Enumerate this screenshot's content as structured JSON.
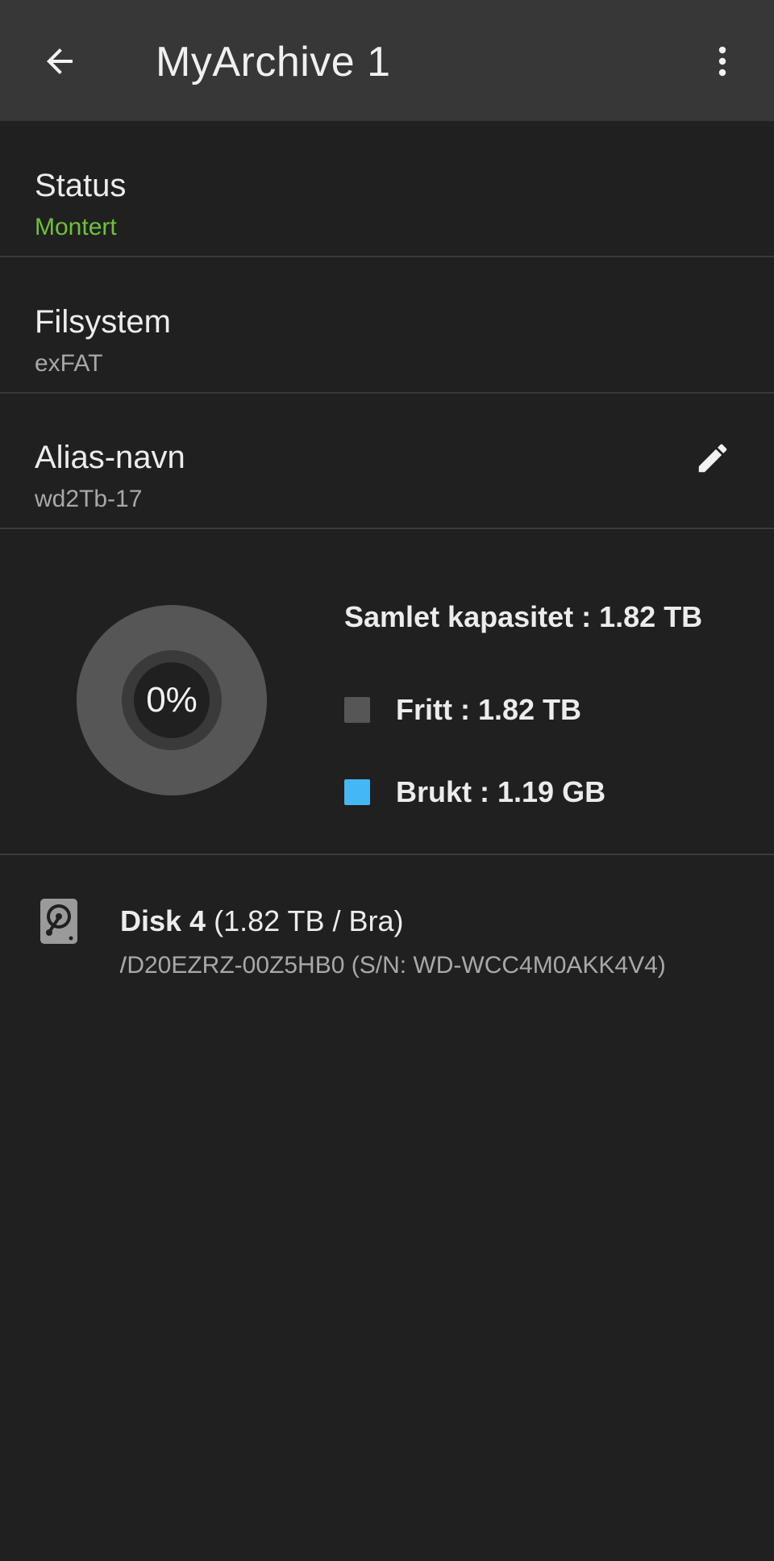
{
  "appbar": {
    "title": "MyArchive 1",
    "back_icon": "arrow-back-icon",
    "menu_icon": "more-vert-icon"
  },
  "status": {
    "label": "Status",
    "value": "Montert",
    "value_color": "#6fc13a"
  },
  "filesystem": {
    "label": "Filsystem",
    "value": "exFAT"
  },
  "alias": {
    "label": "Alias-navn",
    "value": "wd2Tb-17",
    "edit_icon": "pencil-icon"
  },
  "capacity": {
    "used_percent": 0,
    "used_percent_text": "0%",
    "total": "Samlet kapasitet : 1.82 TB",
    "free": "Fritt : 1.82 TB",
    "free_color": "#565656",
    "used": "Brukt : 1.19 GB",
    "used_color": "#44b8f5"
  },
  "disk": {
    "icon": "hard-disk-icon",
    "name": "Disk 4",
    "details": " (1.82 TB / Bra)",
    "subtitle": "WD20EZRZ-00Z5HB0 (S/N: WD-WCC4M0AKK4V4)"
  }
}
